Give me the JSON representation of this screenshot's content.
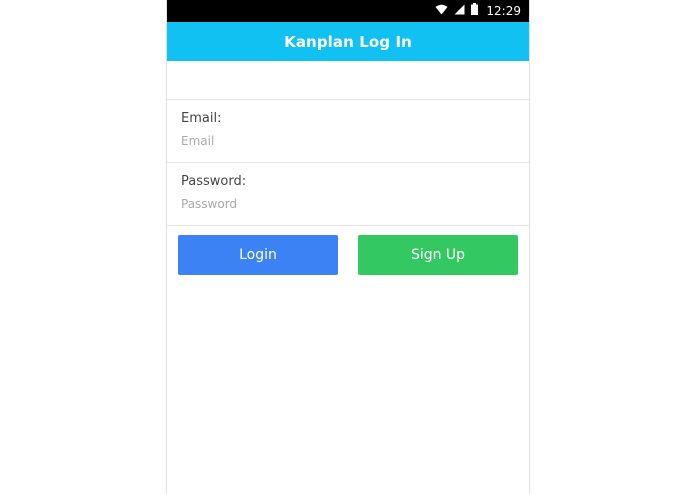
{
  "status_bar": {
    "time": "12:29",
    "icons": [
      "wifi-icon",
      "signal-icon",
      "battery-icon"
    ]
  },
  "header": {
    "title": "Kanplan Log In"
  },
  "form": {
    "email": {
      "label": "Email:",
      "placeholder": "Email",
      "value": ""
    },
    "password": {
      "label": "Password:",
      "placeholder": "Password",
      "value": ""
    }
  },
  "buttons": {
    "login_label": "Login",
    "signup_label": "Sign Up"
  },
  "colors": {
    "header": "#11c1f1",
    "login": "#3d82f5",
    "signup": "#34c862"
  }
}
